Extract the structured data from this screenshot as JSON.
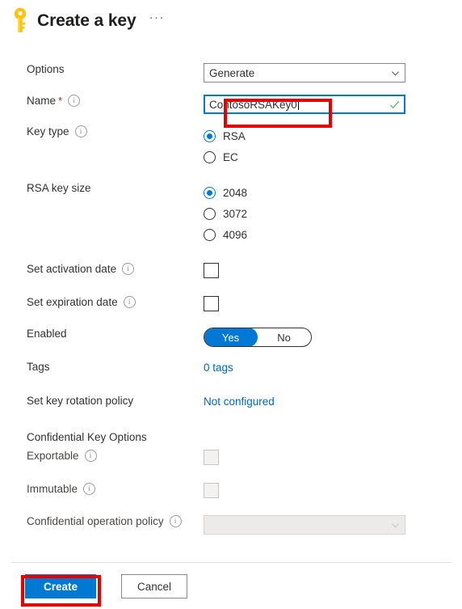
{
  "header": {
    "icon": "key-icon",
    "title": "Create a key",
    "more_menu": "···"
  },
  "form": {
    "options": {
      "label": "Options",
      "value": "Generate"
    },
    "name": {
      "label": "Name",
      "required_mark": "*",
      "value": "ContosoRSAKey0",
      "valid": true
    },
    "key_type": {
      "label": "Key type",
      "selected": "RSA",
      "options": [
        "RSA",
        "EC"
      ]
    },
    "rsa_key_size": {
      "label": "RSA key size",
      "selected": "2048",
      "options": [
        "2048",
        "3072",
        "4096"
      ]
    },
    "set_activation_date": {
      "label": "Set activation date",
      "checked": false
    },
    "set_expiration_date": {
      "label": "Set expiration date",
      "checked": false
    },
    "enabled": {
      "label": "Enabled",
      "on_label": "Yes",
      "off_label": "No",
      "value": "Yes"
    },
    "tags": {
      "label": "Tags",
      "value": "0 tags"
    },
    "key_rotation_policy": {
      "label": "Set key rotation policy",
      "value": "Not configured"
    },
    "confidential_section": {
      "title": "Confidential Key Options",
      "exportable": {
        "label": "Exportable",
        "checked": false,
        "disabled": true
      },
      "immutable": {
        "label": "Immutable",
        "checked": false,
        "disabled": true
      },
      "operation_policy": {
        "label": "Confidential operation policy",
        "value": "",
        "disabled": true
      }
    }
  },
  "footer": {
    "create_label": "Create",
    "cancel_label": "Cancel"
  },
  "colors": {
    "accent": "#0078d4",
    "annotation": "#e60000",
    "link": "#0066cc",
    "required": "#a4262c",
    "valid_check": "#5cb85c",
    "key_icon": "#ffc20e"
  }
}
